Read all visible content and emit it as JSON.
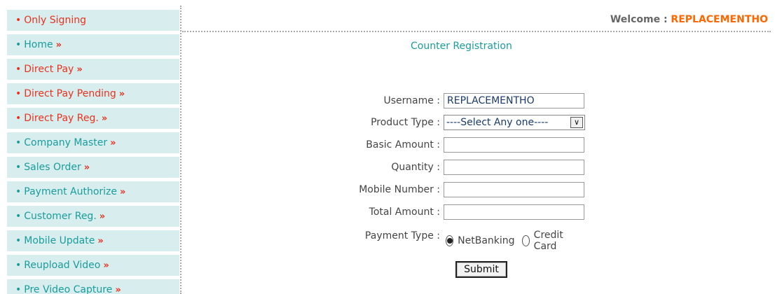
{
  "sidebar": {
    "items": [
      {
        "label": "Only Signing",
        "arrow": ""
      },
      {
        "label": "Home",
        "arrow": "»"
      },
      {
        "label": "Direct Pay",
        "arrow": "»"
      },
      {
        "label": "Direct Pay Pending",
        "arrow": "»"
      },
      {
        "label": "Direct Pay Reg.",
        "arrow": "»"
      },
      {
        "label": "Company Master",
        "arrow": "»"
      },
      {
        "label": "Sales Order",
        "arrow": "»"
      },
      {
        "label": "Payment Authorize",
        "arrow": "»"
      },
      {
        "label": "Customer Reg.",
        "arrow": "»"
      },
      {
        "label": "Mobile Update",
        "arrow": "»"
      },
      {
        "label": "Reupload Video",
        "arrow": "»"
      },
      {
        "label": "Pre Video Capture",
        "arrow": "»"
      }
    ],
    "bullet": "•"
  },
  "header": {
    "welcome_label": "Welcome : ",
    "username": "REPLACEMENTHO"
  },
  "form": {
    "title": "Counter Registration",
    "username_label": "Username :",
    "username_value": "REPLACEMENTHO",
    "product_type_label": "Product Type :",
    "product_type_selected": "----Select Any one----",
    "basic_amount_label": "Basic Amount :",
    "basic_amount_value": "",
    "quantity_label": "Quantity :",
    "quantity_value": "",
    "mobile_label": "Mobile Number :",
    "mobile_value": "",
    "total_amount_label": "Total Amount :",
    "total_amount_value": "",
    "payment_type_label": "Payment Type :",
    "payment_options": [
      "NetBanking",
      "Credit Card"
    ],
    "payment_selected": "NetBanking",
    "submit_label": "Submit"
  },
  "colors": {
    "accent_teal": "#1a9c9c",
    "accent_red": "#e8321e",
    "accent_orange": "#ff6600",
    "sidebar_bg": "#d8eeee"
  }
}
